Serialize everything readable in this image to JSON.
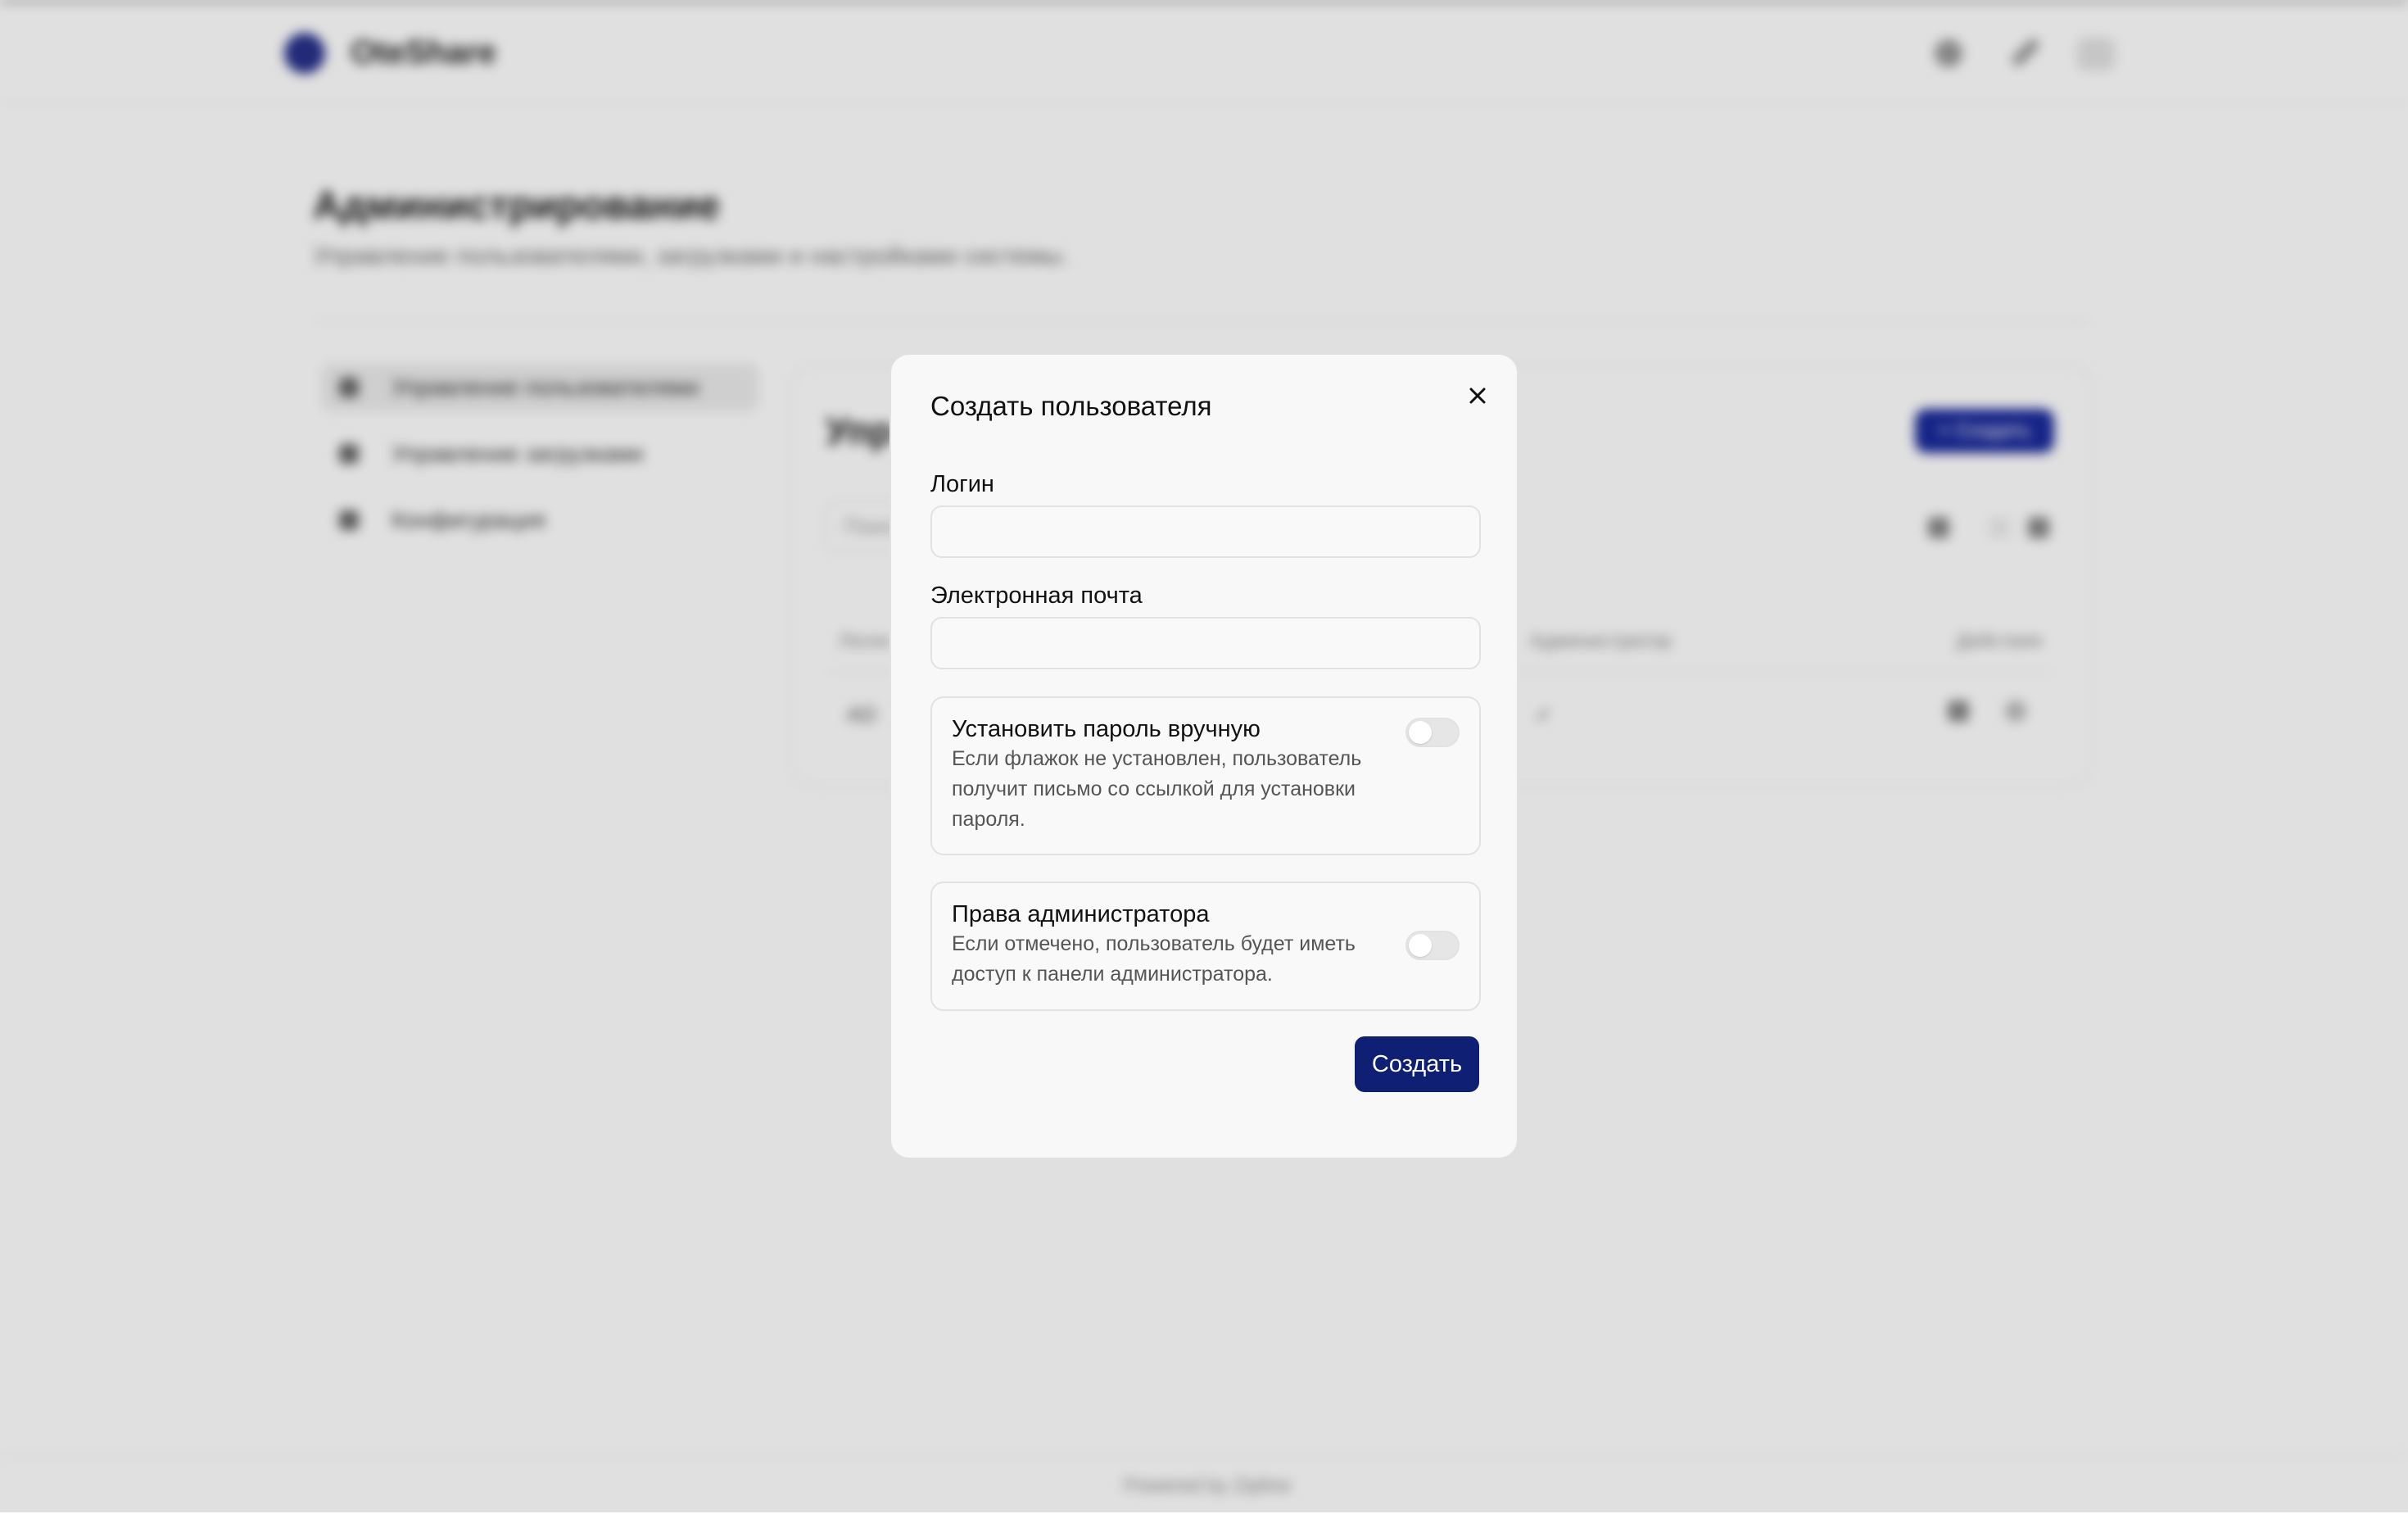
{
  "background": {
    "brand": "OteShare",
    "title": "Администрирование",
    "subtitle": "Управление пользователями, загрузками и настройками системы.",
    "sidebar": [
      {
        "label": "Управление пользователями"
      },
      {
        "label": "Управление загрузками"
      },
      {
        "label": "Конфигурация"
      }
    ],
    "card": {
      "title": "Упр",
      "create_label": "+ Создать",
      "search_placeholder": "Поиск",
      "columns": [
        "Логин",
        "Администратор",
        "Действия"
      ],
      "row_values": [
        "AD",
        "✓"
      ]
    },
    "footer": "Powered by Zipline"
  },
  "modal": {
    "title": "Создать пользователя",
    "login_label": "Логин",
    "login_value": "",
    "email_label": "Электронная почта",
    "email_value": "",
    "manual_password": {
      "title": "Установить пароль вручную",
      "description": "Если флажок не установлен, пользователь получит письмо со ссылкой для установки пароля.",
      "enabled": false
    },
    "admin_rights": {
      "title": "Права администратора",
      "description": "Если отмечено, пользователь будет иметь доступ к панели администратора.",
      "enabled": false
    },
    "submit_label": "Создать"
  },
  "colors": {
    "primary": "#0f1f73",
    "brand_circle": "#27308a"
  }
}
